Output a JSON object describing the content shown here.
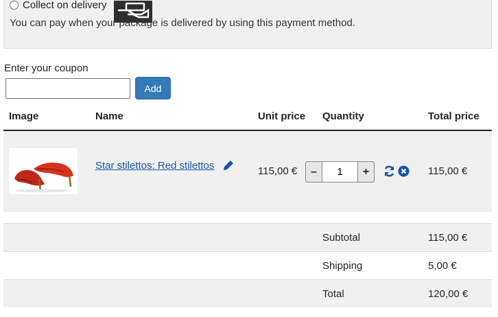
{
  "payment": {
    "method_label": "Collect on delivery",
    "description": "You can pay when your package is delivered by using this payment method.",
    "icon": "hand-card-icon"
  },
  "coupon": {
    "label": "Enter your coupon",
    "value": "",
    "add_label": "Add"
  },
  "table": {
    "headers": {
      "image": "Image",
      "name": "Name",
      "unit_price": "Unit price",
      "quantity": "Quantity",
      "total_price": "Total price"
    },
    "item": {
      "name": "Star stilettos: Red stilettos",
      "unit_price": "115,00 €",
      "quantity": "1",
      "total": "115,00 €",
      "qty_minus": "–",
      "qty_plus": "+"
    }
  },
  "summary": {
    "subtotal_label": "Subtotal",
    "subtotal_value": "115,00 €",
    "shipping_label": "Shipping",
    "shipping_value": "5,00 €",
    "total_label": "Total",
    "total_value": "120,00 €"
  },
  "colors": {
    "link": "#1a52a8",
    "button": "#337ab7",
    "icon_blue": "#1a52a8"
  }
}
